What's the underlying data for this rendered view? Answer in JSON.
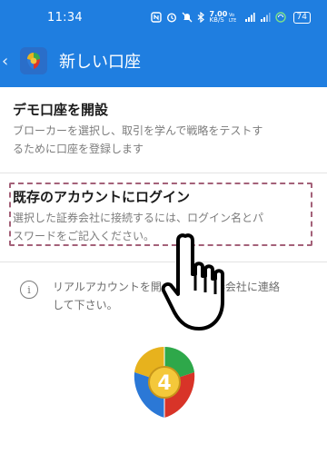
{
  "status_bar": {
    "time": "11:34",
    "net_speed_value": "7.00",
    "net_speed_unit": "KB/S",
    "battery": "74"
  },
  "app_bar": {
    "title": "新しい口座"
  },
  "options": [
    {
      "title": "デモ口座を開設",
      "description_line1": "ブローカーを選択し、取引を学んで戦略をテストす",
      "description_line2": "るために口座を登録します"
    },
    {
      "title": "既存のアカウントにログイン",
      "description_line1": "選択した証券会社に接続するには、ログイン名とパ",
      "description_line2": "スワードをご記入ください。"
    }
  ],
  "info": {
    "line1": "リアルアカウントを開",
    "line1_tail": "証券会社に連絡",
    "line2": "して下さい。"
  },
  "logo": {
    "badge": "4"
  },
  "colors": {
    "primary": "#1f7ee0",
    "highlight_border": "#a46179"
  }
}
